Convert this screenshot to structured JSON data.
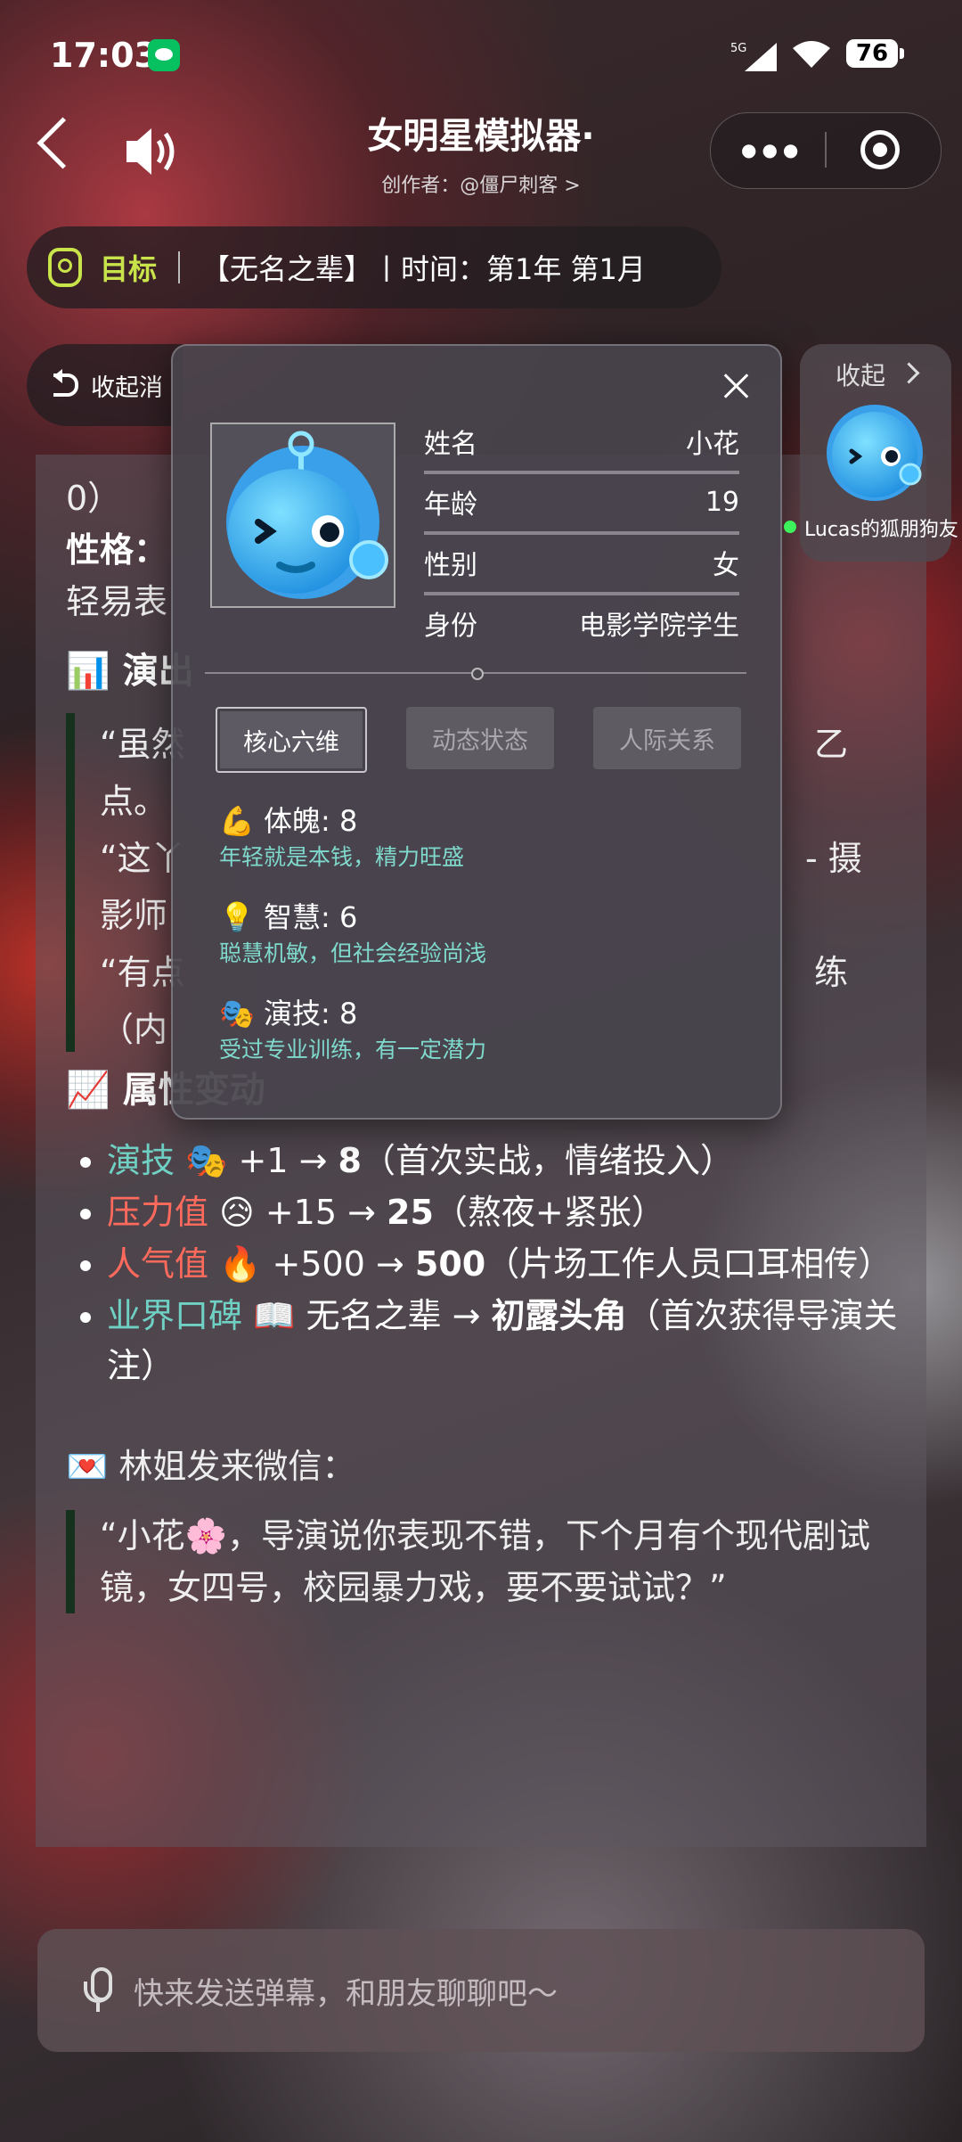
{
  "status": {
    "time": "17:03",
    "network": "5G",
    "battery": "76"
  },
  "header": {
    "title": "女明星模拟器·",
    "subtitle": "创作者：@僵尸刺客 >"
  },
  "goal": {
    "label": "目标",
    "text": "【无名之辈】丨时间：第1年 第1月"
  },
  "collapse_msg": {
    "label": "收起消"
  },
  "main": {
    "line1": "0）",
    "personality_label": "性格：",
    "personality_line": "轻易表",
    "section_acting": "演出",
    "quotes_visible": [
      "“虽然",
      "乙",
      "点。",
      "“这丫",
      "- 摄",
      "影师",
      "“有点",
      "练",
      "（内"
    ],
    "section_attr": "属性变动",
    "attrs": [
      {
        "name": "演技",
        "emoji": "🎭",
        "text": " +1 → ",
        "bold": "8",
        "note": "（首次实战，情绪投入）"
      },
      {
        "name": "压力值",
        "emoji": "😥",
        "text": " +15 → ",
        "bold": "25",
        "note": "（熬夜+紧张）"
      },
      {
        "name": "人气值",
        "emoji": "🔥",
        "text": " +500 → ",
        "bold": "500",
        "note": "（片场工作人员口耳相传）"
      },
      {
        "name": "业界口碑",
        "emoji": "📖",
        "text": " 无名之辈 → ",
        "bold": "初露头角",
        "note": "（首次获得导演关注）"
      }
    ],
    "wechat_title": "林姐发来微信：",
    "wechat_quote": "“小花🌸，导演说你表现不错，下个月有个现代剧试镜，女四号，校园暴力戏，要不要试试？”"
  },
  "panel": {
    "info": [
      {
        "key": "姓名",
        "value": "小花"
      },
      {
        "key": "年龄",
        "value": "19"
      },
      {
        "key": "性别",
        "value": "女"
      },
      {
        "key": "身份",
        "value": "电影学院学生"
      }
    ],
    "tabs": [
      "核心六维",
      "动态状态",
      "人际关系"
    ],
    "stats": [
      {
        "emoji": "💪",
        "name": "体魄: 8",
        "desc": "年轻就是本钱，精力旺盛"
      },
      {
        "emoji": "💡",
        "name": "智慧: 6",
        "desc": "聪慧机敏，但社会经验尚浅"
      },
      {
        "emoji": "🎭",
        "name": "演技: 8",
        "desc": "受过专业训练，有一定潜力"
      }
    ]
  },
  "side": {
    "collapse": "收起",
    "name": "Lucas的狐朋狗友"
  },
  "input": {
    "placeholder": "快来发送弹幕，和朋友聊聊吧～"
  },
  "colors": {
    "accent_green": "#c8e44a",
    "teal": "#6fd0c4",
    "red": "#ff6a5d",
    "online": "#3df25b"
  }
}
